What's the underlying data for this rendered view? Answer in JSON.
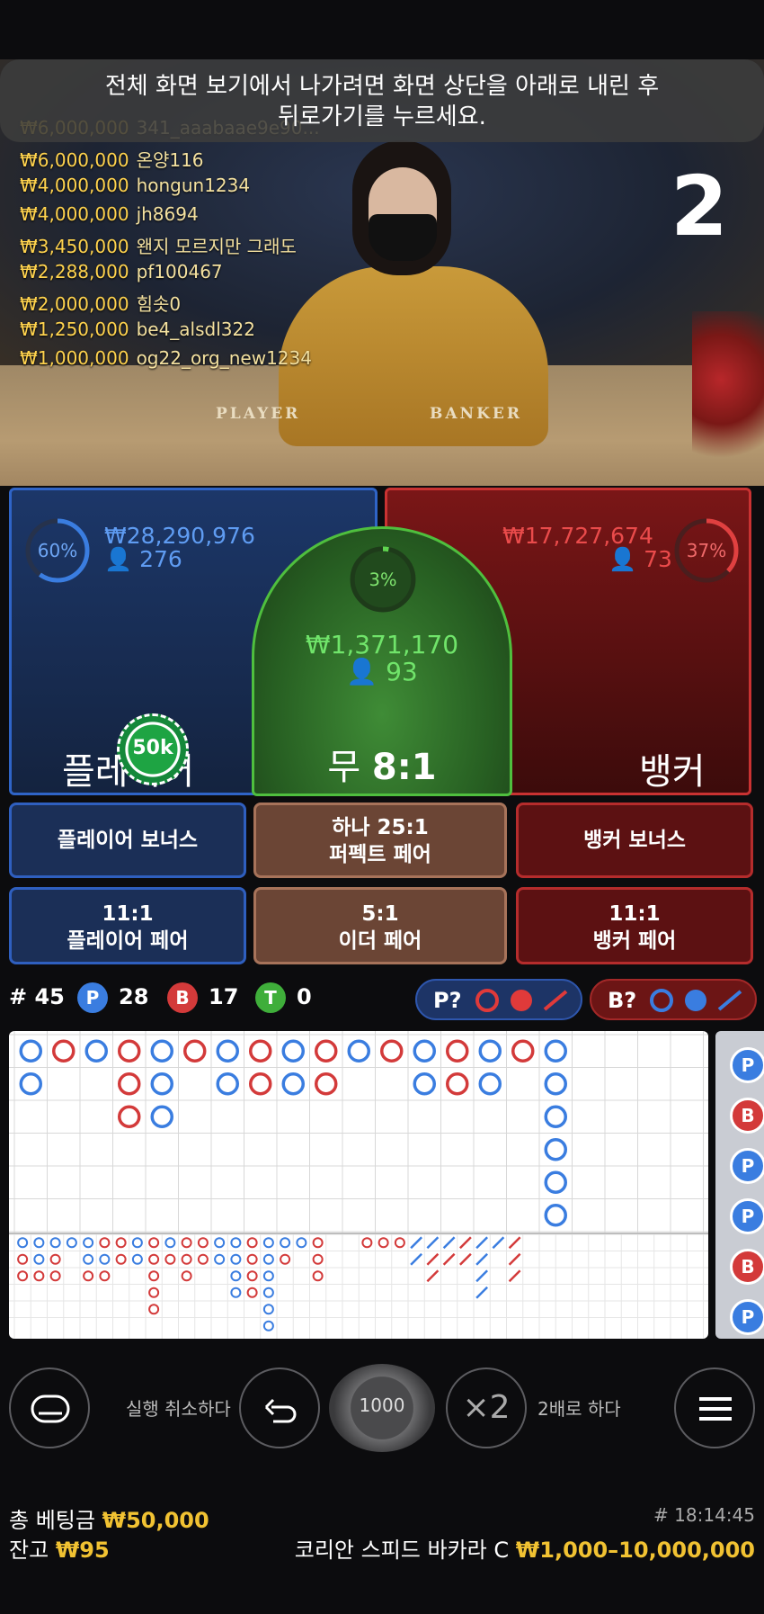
{
  "banner": {
    "line1": "전체 화면 보기에서 나가려면 화면 상단을 아래로 내린 후",
    "line2": "뒤로가기를 누르세요."
  },
  "video": {
    "round_number": "2",
    "table_labels": {
      "player": "PLAYER",
      "banker": "BANKER"
    },
    "winners": [
      {
        "amount": "₩6,000,000",
        "name": "341_aaabaae9e90..."
      },
      {
        "amount": "₩6,000,000",
        "name": "온양116"
      },
      {
        "amount": "₩4,000,000",
        "name": "hongun1234"
      },
      {
        "amount": "₩4,000,000",
        "name": "jh8694"
      },
      {
        "amount": "₩3,450,000",
        "name": "왠지 모르지만 그래도"
      },
      {
        "amount": "₩2,288,000",
        "name": "pf100467"
      },
      {
        "amount": "₩2,000,000",
        "name": "힘솟0"
      },
      {
        "amount": "₩1,250,000",
        "name": "be4_alsdl322"
      },
      {
        "amount": "₩1,000,000",
        "name": "og22_org_new1234"
      }
    ]
  },
  "bets": {
    "player": {
      "percent": "60%",
      "percent_value": 0.6,
      "total": "₩28,290,976",
      "players": "276",
      "label": "플레이어"
    },
    "tie": {
      "percent": "3%",
      "percent_value": 0.03,
      "total": "₩1,371,170",
      "players": "93",
      "label": "무",
      "payout": "8:1"
    },
    "banker": {
      "percent": "37%",
      "percent_value": 0.37,
      "total": "₩17,727,674",
      "players": "73",
      "label": "뱅커"
    },
    "placed_chip": "50k"
  },
  "side_bets": {
    "player_bonus": "플레이어 보너스",
    "perfect_pair_line1": "하나 25:1",
    "perfect_pair_line2": "퍼펙트 페어",
    "banker_bonus": "뱅커 보너스",
    "player_pair_odds": "11:1",
    "player_pair": "플레이어 페어",
    "either_pair_odds": "5:1",
    "either_pair": "이더 페어",
    "banker_pair_odds": "11:1",
    "banker_pair": "뱅커 페어"
  },
  "stats": {
    "hand": "# 45",
    "p_letter": "P",
    "p_count": "28",
    "b_letter": "B",
    "b_count": "17",
    "t_letter": "T",
    "t_count": "0",
    "ask_player": "P?",
    "ask_banker": "B?"
  },
  "road_side": [
    "P",
    "B",
    "P",
    "P",
    "B",
    "P"
  ],
  "controls": {
    "undo_label": "실행 취소하다",
    "chip_value": "1000",
    "double_symbol": "×2",
    "double_label": "2배로 하다"
  },
  "footer": {
    "total_bet_label": "총 베팅금",
    "total_bet": "₩50,000",
    "balance_label": "잔고",
    "balance": "₩95",
    "time": "# 18:14:45",
    "table_name": "코리안 스피드 바카라 C",
    "limits": "₩1,000–10,000,000"
  },
  "colors": {
    "player": "#3a7de0",
    "banker": "#d33a3a",
    "tie": "#3fae3a",
    "gold": "#f1c232"
  },
  "big_road_columns": [
    [
      "P",
      "P"
    ],
    [
      "B"
    ],
    [
      "P"
    ],
    [
      "B",
      "B",
      "B"
    ],
    [
      "P",
      "P",
      "P"
    ],
    [
      "B"
    ],
    [
      "P",
      "P"
    ],
    [
      "B",
      "B"
    ],
    [
      "P",
      "P"
    ],
    [
      "B",
      "B"
    ],
    [
      "P"
    ],
    [
      "B"
    ],
    [
      "P",
      "P"
    ],
    [
      "B",
      "B"
    ],
    [
      "P",
      "P"
    ],
    [
      "B"
    ],
    [
      "P",
      "P",
      "P",
      "P",
      "P",
      "P"
    ]
  ],
  "bead_road": [
    [
      [
        "P",
        "B",
        "B"
      ],
      [
        "P",
        "P",
        "B"
      ],
      [
        "P",
        "B",
        "B"
      ],
      [
        "P"
      ],
      [
        "P",
        "P",
        "B"
      ],
      [
        "B",
        "P",
        "B"
      ]
    ],
    [
      [
        "B",
        "B"
      ],
      [
        "P",
        "P"
      ],
      [
        "B",
        "B",
        "B",
        "B",
        "B"
      ],
      [
        "P",
        "B"
      ],
      [
        "B",
        "B",
        "B"
      ],
      [
        "B",
        "B"
      ]
    ],
    [
      [
        "P",
        "P"
      ],
      [
        "P",
        "P",
        "P",
        "P"
      ],
      [
        "B",
        "B",
        "B",
        "B"
      ],
      [
        "P",
        "P",
        "P",
        "P",
        "P",
        "P"
      ],
      [
        "P",
        "B"
      ],
      [
        "P"
      ]
    ],
    [
      [
        "B",
        "B",
        "B"
      ],
      [],
      [],
      [
        "B"
      ],
      [
        "B"
      ],
      [
        "B"
      ]
    ],
    [
      [
        "PL",
        "PL"
      ],
      [
        "PL",
        "BL",
        "BL"
      ],
      [
        "PL",
        "BL"
      ],
      [
        "BL",
        "BL"
      ],
      [
        "PL",
        "PL",
        "PL",
        "PL"
      ],
      [
        "PL"
      ],
      [
        "BL",
        "BL",
        "BL"
      ]
    ]
  ]
}
